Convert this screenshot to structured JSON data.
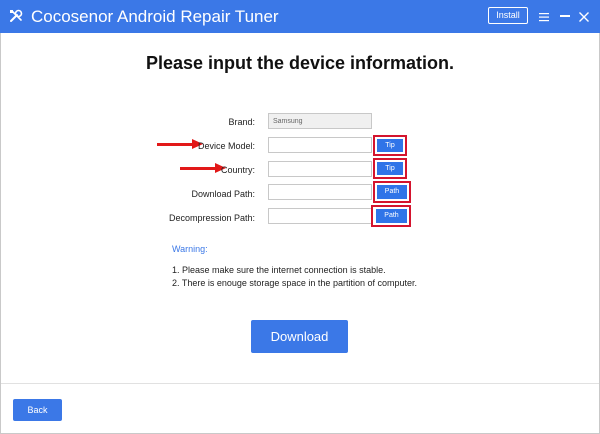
{
  "app": {
    "title": "Cocosenor Android Repair Tuner",
    "install_label": "Install"
  },
  "colors": {
    "accent": "#3b78e7",
    "highlight": "#d4142e",
    "arrow": "#e21818"
  },
  "heading": "Please input the device information.",
  "form": {
    "brand": {
      "label": "Brand:",
      "value": "Samsung"
    },
    "device_model": {
      "label": "Device Model:",
      "value": "",
      "button": "Tip"
    },
    "country": {
      "label": "Country:",
      "value": "",
      "button": "Tip"
    },
    "download_path": {
      "label": "Download Path:",
      "value": "",
      "button": "Path"
    },
    "decompression_path": {
      "label": "Decompression Path:",
      "value": "",
      "button": "Path"
    }
  },
  "warning": {
    "title": "Warning:",
    "lines": [
      "1. Please make sure the internet connection is stable.",
      "2. There is enouge storage space in the partition of computer."
    ]
  },
  "download_label": "Download",
  "back_label": "Back",
  "icons": {
    "app": "tools-icon",
    "menu": "menu-icon",
    "minimize": "minimize-icon",
    "close": "close-icon",
    "arrow": "arrow-right-icon"
  }
}
